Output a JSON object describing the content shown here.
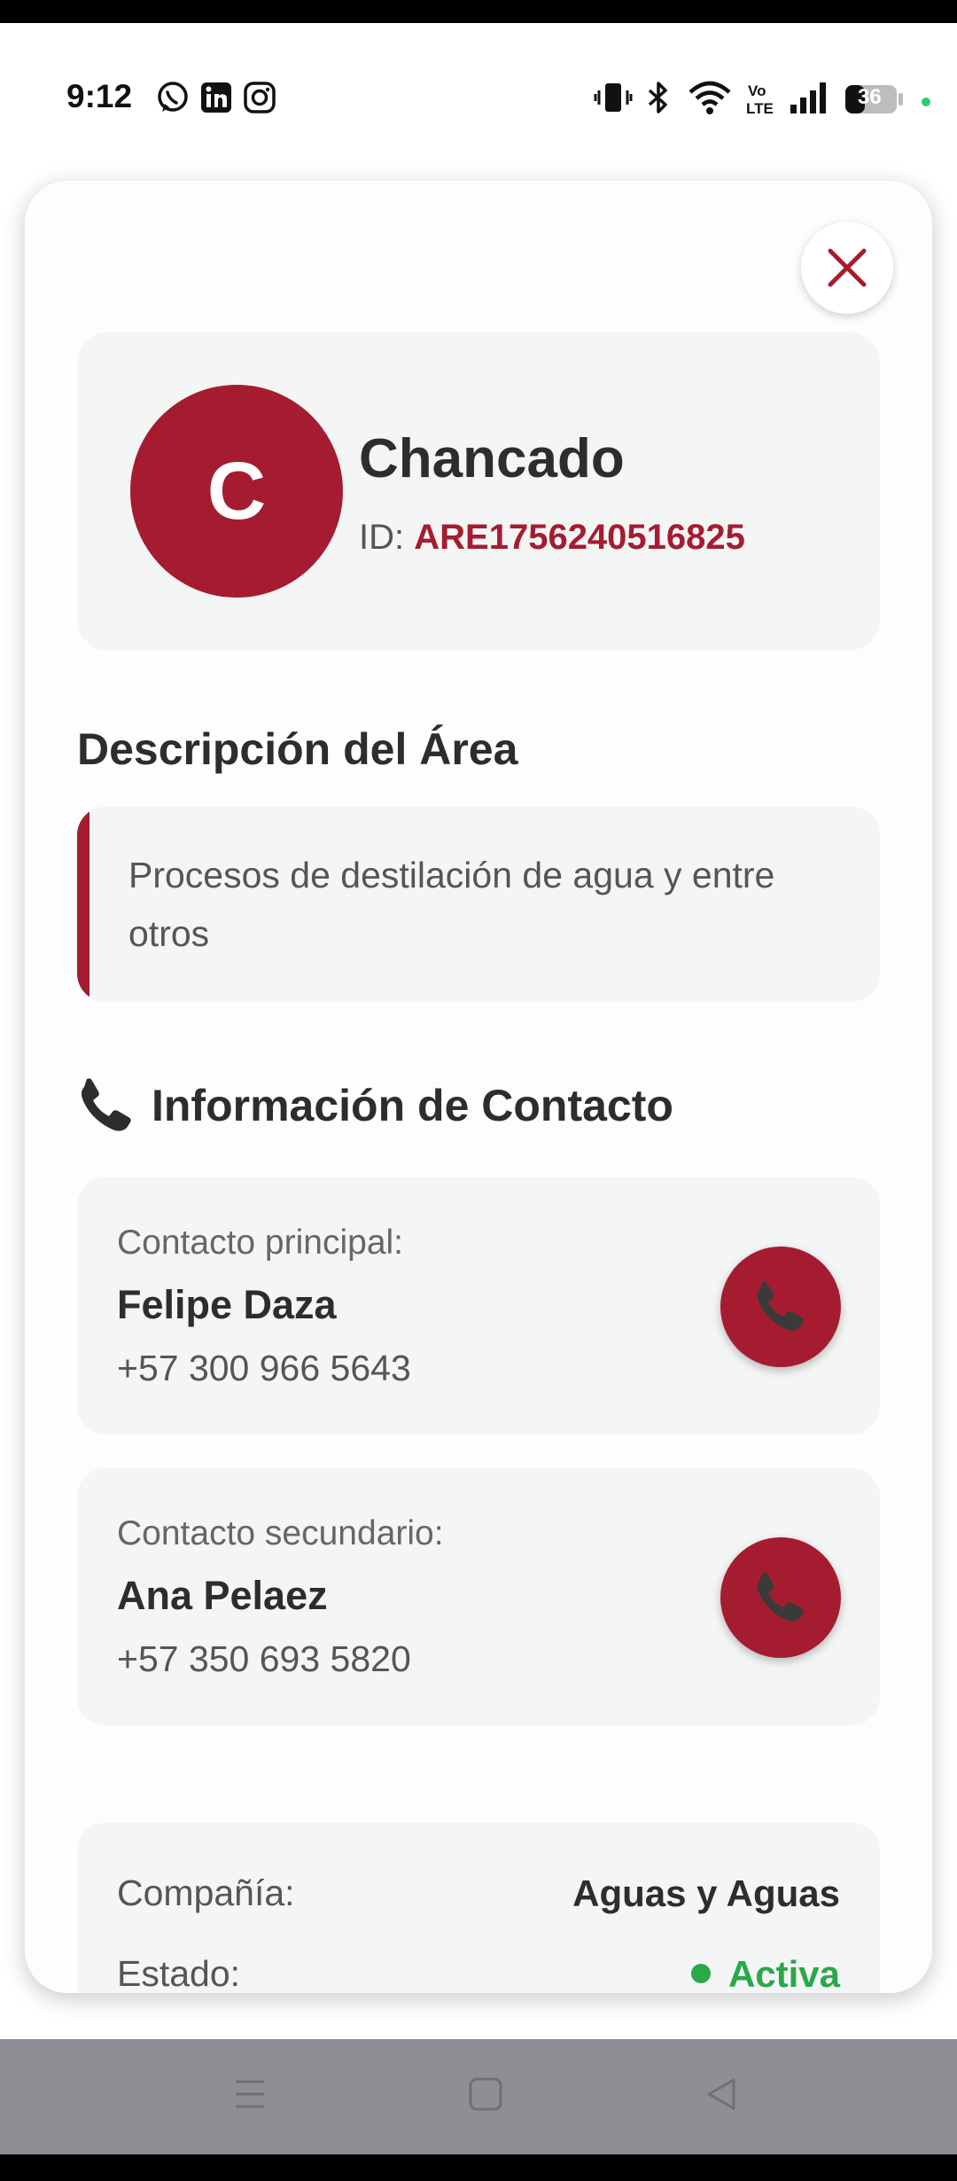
{
  "status_bar": {
    "time": "9:12",
    "battery": "36",
    "app_icons": [
      "whatsapp-icon",
      "linkedin-icon",
      "instagram-icon"
    ],
    "system_icons": [
      "vibrate-icon",
      "bluetooth-icon",
      "wifi-icon",
      "volte-icon",
      "signal-icon",
      "battery-icon"
    ],
    "volte_label": "Vo\nLTE"
  },
  "area": {
    "avatar_letter": "C",
    "name": "Chancado",
    "id_label": "ID:",
    "id_value": "ARE1756240516825"
  },
  "description": {
    "title": "Descripción del Área",
    "text": "Procesos de destilación de agua y entre otros"
  },
  "contact": {
    "title": "Información de Contacto",
    "primary": {
      "label": "Contacto principal:",
      "name": "Felipe Daza",
      "phone": "+57 300 966 5643"
    },
    "secondary": {
      "label": "Contacto secundario:",
      "name": "Ana Pelaez",
      "phone": "+57 350 693 5820"
    }
  },
  "details": {
    "company_label": "Compañía:",
    "company_value": "Aguas y Aguas",
    "status_label": "Estado:",
    "status_value": "Activa"
  },
  "colors": {
    "accent": "#a51c30",
    "status_active": "#2aa84a",
    "card_bg": "#f4f5f5"
  }
}
